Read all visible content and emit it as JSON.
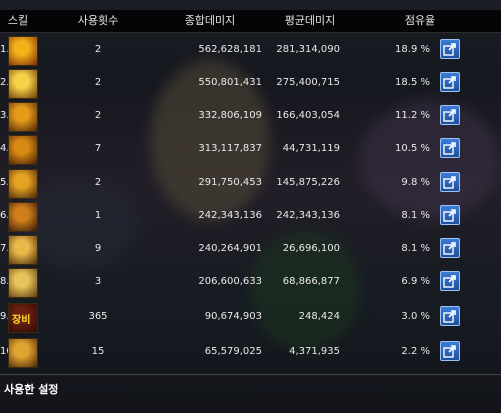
{
  "header": {
    "skill": "스킬",
    "uses": "사용횟수",
    "total": "종합데미지",
    "avg": "평균데미지",
    "share": "점유율"
  },
  "rows": [
    {
      "index": "1.",
      "uses": "2",
      "total": "562,628,181",
      "avg": "281,314,090",
      "pct": "18.9 %",
      "icon": "sun-burst-icon",
      "c1": "#f3b21a",
      "c2": "#7a2a06"
    },
    {
      "index": "2.",
      "uses": "2",
      "total": "550,801,431",
      "avg": "275,400,715",
      "pct": "18.5 %",
      "icon": "golden-orb-icon",
      "c1": "#f6d24a",
      "c2": "#6b3a05"
    },
    {
      "index": "3.",
      "uses": "2",
      "total": "332,806,109",
      "avg": "166,403,054",
      "pct": "11.2 %",
      "icon": "swirl-icon",
      "c1": "#e59a1a",
      "c2": "#4a2306"
    },
    {
      "index": "4.",
      "uses": "7",
      "total": "313,117,837",
      "avg": "44,731,119",
      "pct": "10.5 %",
      "icon": "pillars-icon",
      "c1": "#d98a14",
      "c2": "#3e1d04"
    },
    {
      "index": "5.",
      "uses": "2",
      "total": "291,750,453",
      "avg": "145,875,226",
      "pct": "9.8 %",
      "icon": "flame-ring-icon",
      "c1": "#e6a223",
      "c2": "#402008"
    },
    {
      "index": "6.",
      "uses": "1",
      "total": "242,343,136",
      "avg": "242,343,136",
      "pct": "8.1 %",
      "icon": "vortex-icon",
      "c1": "#cf7e1b",
      "c2": "#2e1606"
    },
    {
      "index": "7.",
      "uses": "9",
      "total": "240,264,901",
      "avg": "26,696,100",
      "pct": "8.1 %",
      "icon": "spiral-icon",
      "c1": "#e9b84a",
      "c2": "#4a2a08"
    },
    {
      "index": "8.",
      "uses": "3",
      "total": "206,600,633",
      "avg": "68,866,877",
      "pct": "6.9 %",
      "icon": "wings-icon",
      "c1": "#e8c25a",
      "c2": "#5a3a10"
    },
    {
      "index": "9.",
      "uses": "365",
      "total": "90,674,903",
      "avg": "248,424",
      "pct": "3.0 %",
      "icon": "equipment-icon",
      "label": "장비",
      "c1": "#6a2010",
      "c2": "#2a0a05"
    },
    {
      "index": "10.",
      "uses": "15",
      "total": "65,579,025",
      "avg": "4,371,935",
      "pct": "2.2 %",
      "icon": "dragon-icon",
      "c1": "#e0a530",
      "c2": "#4a2505"
    }
  ],
  "footer": {
    "settings": "사용한 설정"
  }
}
